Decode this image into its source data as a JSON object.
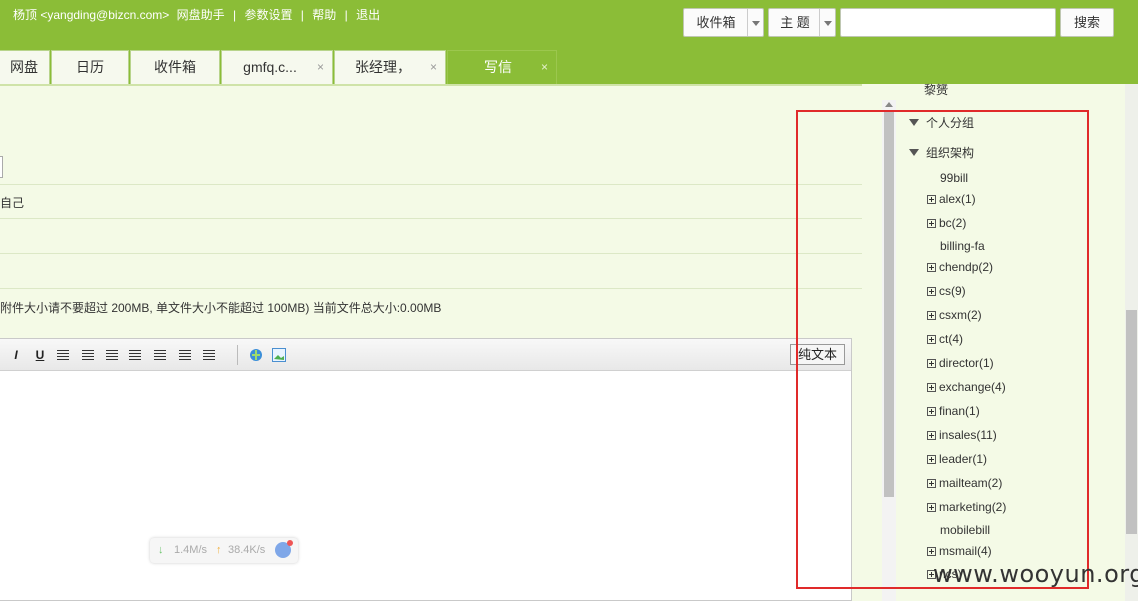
{
  "header": {
    "user": "杨顶 <yangding@bizcn.com>",
    "links": [
      "网盘助手",
      "参数设置",
      "帮助",
      "退出"
    ],
    "separator": "|",
    "inbox_select": "收件箱",
    "theme_select": "主 题",
    "search_value": "",
    "search_button": "搜索"
  },
  "tabs": [
    {
      "label": "网盘",
      "closable": false
    },
    {
      "label": "日历",
      "closable": false
    },
    {
      "label": "收件箱",
      "closable": false
    },
    {
      "label": "gmfq.c...",
      "closable": true
    },
    {
      "label": "张经理，",
      "closable": true
    },
    {
      "label": "写信",
      "closable": true,
      "active": true
    }
  ],
  "tab_close": "×",
  "compose": {
    "self_fragment": "自己",
    "attachment_note": "附件大小请不要超过 200MB, 单文件大小不能超过 100MB) 当前文件总大小:0.00MB",
    "plain_text_button": "纯文本",
    "toolbar_labels": {
      "italic": "I",
      "underline": "U"
    }
  },
  "speed_widget": {
    "down": "1.4M/s",
    "up": "38.4K/s",
    "down_arrow": "↓",
    "up_arrow": "↑"
  },
  "contacts_tree": {
    "top_item": "黎赟",
    "groups": [
      "个人分组",
      "组织架构"
    ],
    "org_items": [
      {
        "label": "99bill",
        "expandable": false
      },
      {
        "label": "alex(1)",
        "expandable": true
      },
      {
        "label": "bc(2)",
        "expandable": true
      },
      {
        "label": "billing-fa",
        "expandable": false
      },
      {
        "label": "chendp(2)",
        "expandable": true
      },
      {
        "label": "cs(9)",
        "expandable": true
      },
      {
        "label": "csxm(2)",
        "expandable": true
      },
      {
        "label": "ct(4)",
        "expandable": true
      },
      {
        "label": "director(1)",
        "expandable": true
      },
      {
        "label": "exchange(4)",
        "expandable": true
      },
      {
        "label": "finan(1)",
        "expandable": true
      },
      {
        "label": "insales(11)",
        "expandable": true
      },
      {
        "label": "leader(1)",
        "expandable": true
      },
      {
        "label": "mailteam(2)",
        "expandable": true
      },
      {
        "label": "marketing(2)",
        "expandable": true
      },
      {
        "label": "mobilebill",
        "expandable": false
      },
      {
        "label": "msmail(4)",
        "expandable": true
      },
      {
        "label": "ncs)",
        "expandable": true
      }
    ]
  },
  "watermark": "www.wooyun.org",
  "colors": {
    "brand_green": "#8bbd37",
    "highlight_box": "#e02a2a",
    "panel_bg": "#f4fae6"
  }
}
